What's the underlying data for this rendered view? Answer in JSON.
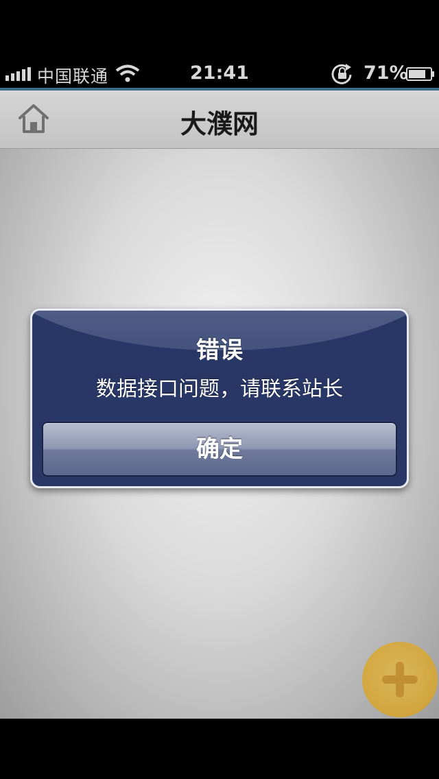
{
  "status_bar": {
    "carrier": "中国联通",
    "time": "21:41",
    "battery_percent": "71%",
    "icons": [
      "signal-icon",
      "wifi-icon",
      "rotation-lock-icon",
      "battery-icon"
    ]
  },
  "nav": {
    "title": "大濮网",
    "home_icon": "home-icon"
  },
  "alert": {
    "title": "错误",
    "message": "数据接口问题，请联系站长",
    "button_label": "确定"
  },
  "fab": {
    "icon": "plus-icon",
    "color": "#d9a52c"
  },
  "colors": {
    "alert_bg": "#283766",
    "nav_bg": "#c8c8c8",
    "accent_line": "#3a6f8c"
  }
}
